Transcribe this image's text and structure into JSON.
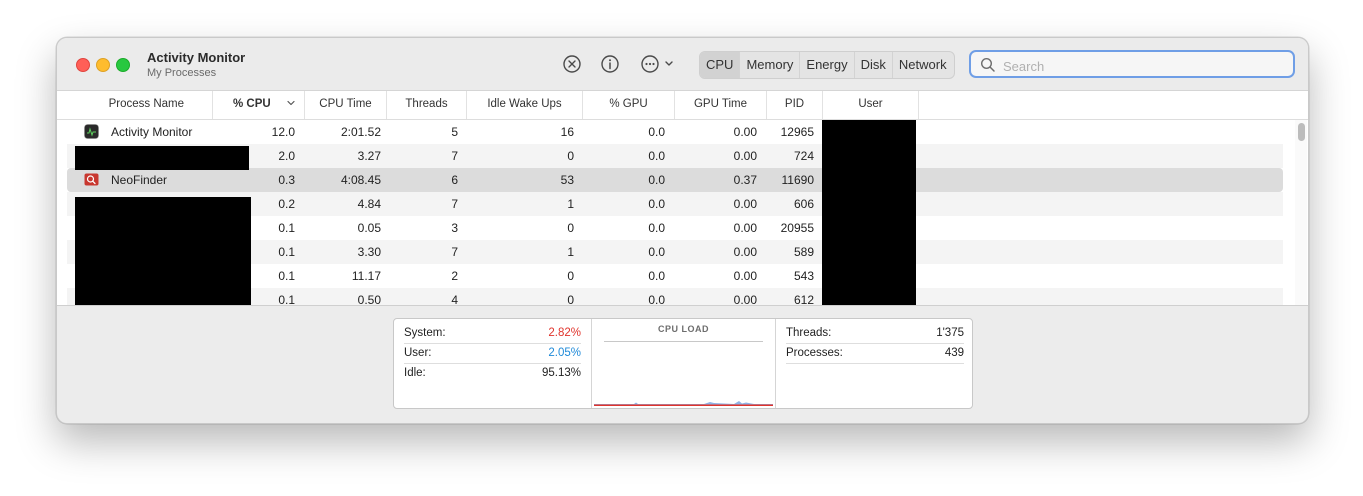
{
  "window": {
    "title": "Activity Monitor",
    "subtitle": "My Processes"
  },
  "toolbar": {
    "stop_icon": "x-circle-icon",
    "info_icon": "info-circle-icon",
    "more_icon": "ellipsis-circle-icon",
    "tabs": [
      "CPU",
      "Memory",
      "Energy",
      "Disk",
      "Network"
    ],
    "active_tab": "CPU"
  },
  "search": {
    "placeholder": "Search",
    "value": ""
  },
  "table": {
    "columns": [
      "Process Name",
      "% CPU",
      "CPU Time",
      "Threads",
      "Idle Wake Ups",
      "% GPU",
      "GPU Time",
      "PID",
      "User"
    ],
    "sort_column": "% CPU",
    "rows": [
      {
        "name": "Activity Monitor",
        "cpu": "12.0",
        "cpu_time": "2:01.52",
        "threads": "5",
        "idle_wake_ups": "16",
        "gpu": "0.0",
        "gpu_time": "0.00",
        "pid": "12965",
        "icon": "activity-monitor-icon"
      },
      {
        "name": "",
        "cpu": "2.0",
        "cpu_time": "3.27",
        "threads": "7",
        "idle_wake_ups": "0",
        "gpu": "0.0",
        "gpu_time": "0.00",
        "pid": "724"
      },
      {
        "name": "NeoFinder",
        "cpu": "0.3",
        "cpu_time": "4:08.45",
        "threads": "6",
        "idle_wake_ups": "53",
        "gpu": "0.0",
        "gpu_time": "0.37",
        "pid": "11690",
        "icon": "neofinder-icon"
      },
      {
        "name": "",
        "cpu": "0.2",
        "cpu_time": "4.84",
        "threads": "7",
        "idle_wake_ups": "1",
        "gpu": "0.0",
        "gpu_time": "0.00",
        "pid": "606"
      },
      {
        "name": "",
        "cpu": "0.1",
        "cpu_time": "0.05",
        "threads": "3",
        "idle_wake_ups": "0",
        "gpu": "0.0",
        "gpu_time": "0.00",
        "pid": "20955"
      },
      {
        "name": "",
        "cpu": "0.1",
        "cpu_time": "3.30",
        "threads": "7",
        "idle_wake_ups": "1",
        "gpu": "0.0",
        "gpu_time": "0.00",
        "pid": "589"
      },
      {
        "name": "",
        "cpu": "0.1",
        "cpu_time": "11.17",
        "threads": "2",
        "idle_wake_ups": "0",
        "gpu": "0.0",
        "gpu_time": "0.00",
        "pid": "543"
      },
      {
        "name": "",
        "cpu": "0.1",
        "cpu_time": "0.50",
        "threads": "4",
        "idle_wake_ups": "0",
        "gpu": "0.0",
        "gpu_time": "0.00",
        "pid": "612"
      }
    ]
  },
  "summary": {
    "system_label": "System:",
    "system_value": "2.82%",
    "user_label": "User:",
    "user_value": "2.05%",
    "idle_label": "Idle:",
    "idle_value": "95.13%",
    "cpu_load_title": "CPU LOAD",
    "threads_label": "Threads:",
    "threads_value": "1'375",
    "processes_label": "Processes:",
    "processes_value": "439"
  },
  "colors": {
    "system": "#e0342c",
    "user": "#1f8ad8",
    "selected_row": "#dcdcdc",
    "search_focus": "#6f9ee6"
  }
}
